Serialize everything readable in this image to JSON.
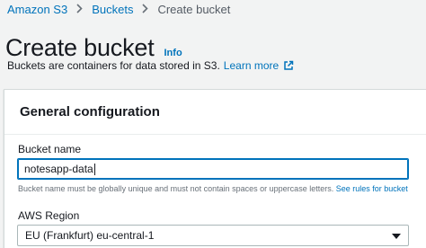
{
  "breadcrumb": {
    "items": [
      {
        "label": "Amazon S3"
      },
      {
        "label": "Buckets"
      },
      {
        "label": "Create bucket"
      }
    ]
  },
  "header": {
    "title": "Create bucket",
    "info_label": "Info",
    "description": "Buckets are containers for data stored in S3.",
    "learn_more": "Learn more"
  },
  "general_configuration": {
    "heading": "General configuration",
    "bucket_name": {
      "label": "Bucket name",
      "value": "notesapp-data",
      "hint": "Bucket name must be globally unique and must not contain spaces or uppercase letters.",
      "hint_link": "See rules for bucket"
    },
    "region": {
      "label": "AWS Region",
      "selected": "EU (Frankfurt) eu-central-1"
    }
  },
  "colors": {
    "link": "#0073bb",
    "background": "#f2f3f3",
    "text": "#16191f"
  },
  "icons": [
    "chevron-right-icon",
    "external-link-icon",
    "caret-down-icon"
  ]
}
